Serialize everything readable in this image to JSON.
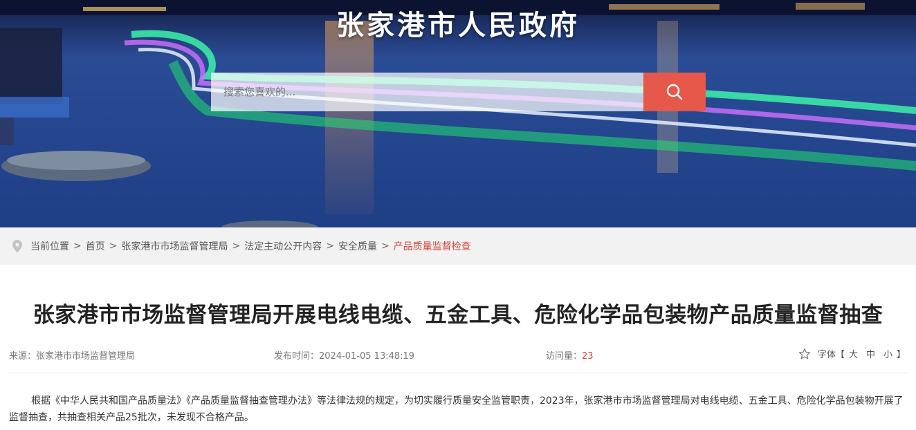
{
  "header": {
    "site_title": "张家港市人民政府",
    "search_placeholder": "搜索您喜欢的...",
    "search_icon": "search-icon"
  },
  "breadcrumb": {
    "prefix": "当前位置",
    "items": [
      "首页",
      "张家港市市场监督管理局",
      "法定主动公开内容",
      "安全质量"
    ],
    "current": "产品质量监督检查",
    "separator": ">"
  },
  "article": {
    "title": "张家港市市场监督管理局开展电线电缆、五金工具、危险化学品包装物产品质量监督抽查",
    "source_label": "来源：张家港市市场监督管理局",
    "pubtime_label": "发布时间：2024-01-05 13:48:19",
    "views_label": "访问量：",
    "views_count": "23",
    "fontsize": {
      "label": "字体【",
      "large": "大",
      "medium": "中",
      "small": "小",
      "close": "】"
    },
    "body": "根据《中华人民共和国产品质量法》《产品质量监督抽查管理办法》等法律法规的规定，为切实履行质量安全监管职责，2023年，张家港市市场监督管理局对电线电缆、五金工具、危险化学品包装物开展了监督抽查，共抽查相关产品25批次，未发现不合格产品。"
  },
  "colors": {
    "accent": "#e5584a",
    "current_crumb": "#d9433a"
  }
}
